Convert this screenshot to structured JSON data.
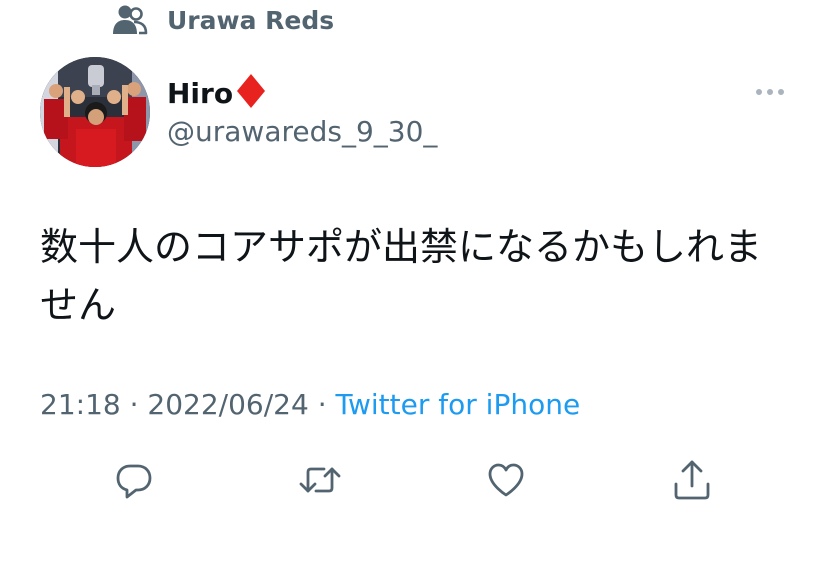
{
  "community": {
    "label": "Urawa Reds",
    "icon": "users-icon"
  },
  "author": {
    "display_name": "Hiro",
    "badge_icon": "red-diamond-icon",
    "handle": "@urawareds_9_30_",
    "avatar": "avatar-photo"
  },
  "tweet": {
    "text": "数十人のコアサポが出禁になるかもしれません",
    "time": "21:18",
    "separator": "·",
    "date": "2022/06/24",
    "source": "Twitter for iPhone"
  },
  "actions": [
    {
      "name": "reply",
      "icon": "reply-icon"
    },
    {
      "name": "retweet",
      "icon": "retweet-icon"
    },
    {
      "name": "like",
      "icon": "heart-icon"
    },
    {
      "name": "share",
      "icon": "share-icon"
    }
  ],
  "colors": {
    "text": "#0f1419",
    "secondary": "#536471",
    "link": "#1d9bf0",
    "diamond": "#e8231f",
    "background": "#ffffff"
  }
}
